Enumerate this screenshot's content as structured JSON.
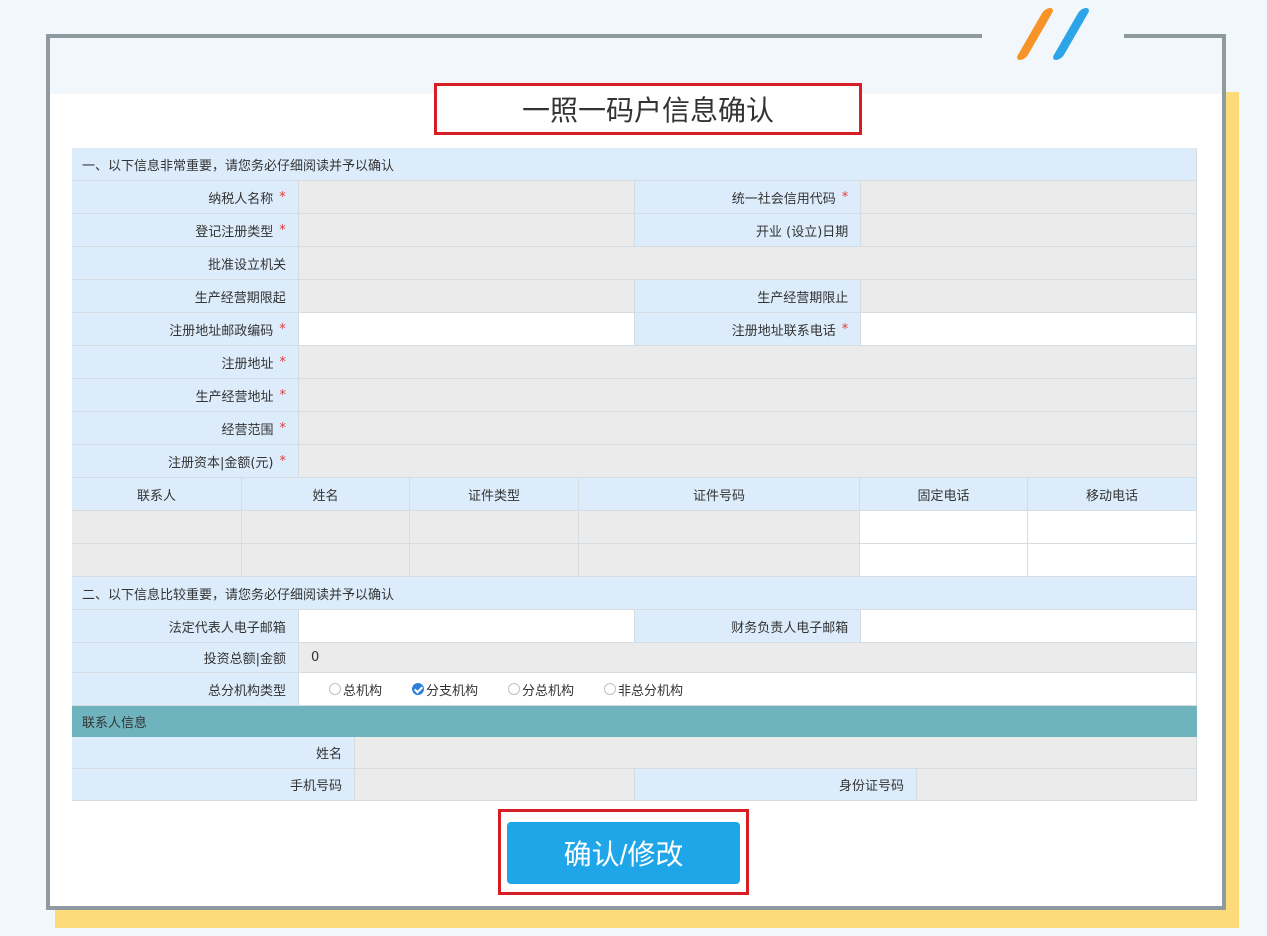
{
  "title": "一照一码户信息确认",
  "section1": "一、以下信息非常重要，请您务必仔细阅读并予以确认",
  "section2": "二、以下信息比较重要，请您务必仔细阅读并予以确认",
  "required_mark": "*",
  "fields": {
    "taxpayer_name": "纳税人名称",
    "credit_code": "统一社会信用代码",
    "reg_type": "登记注册类型",
    "open_date": "开业 (设立)日期",
    "approval_org": "批准设立机关",
    "period_start": "生产经营期限起",
    "period_end": "生产经营期限止",
    "postcode": "注册地址邮政编码",
    "reg_phone": "注册地址联系电话",
    "reg_address": "注册地址",
    "biz_address": "生产经营地址",
    "biz_scope": "经营范围",
    "capital": "注册资本|金额(元)",
    "legal_email": "法定代表人电子邮箱",
    "finance_email": "财务负责人电子邮箱",
    "investment": "投资总额|金额",
    "investment_value": "0",
    "org_type": "总分机构类型"
  },
  "contact_table": {
    "headers": [
      "联系人",
      "姓名",
      "证件类型",
      "证件号码",
      "固定电话",
      "移动电话"
    ]
  },
  "org_options": [
    {
      "label": "总机构",
      "checked": false
    },
    {
      "label": "分支机构",
      "checked": true
    },
    {
      "label": "分总机构",
      "checked": false
    },
    {
      "label": "非总分机构",
      "checked": false
    }
  ],
  "contact_info": {
    "header": "联系人信息",
    "name": "姓名",
    "mobile": "手机号码",
    "id_number": "身份证号码"
  },
  "confirm_button": "确认/修改",
  "colors": {
    "accent_red": "#d81e25",
    "button_blue": "#1ea6e8",
    "label_bg": "#dcecfb",
    "contact_header_bg": "#6fb3bf"
  }
}
